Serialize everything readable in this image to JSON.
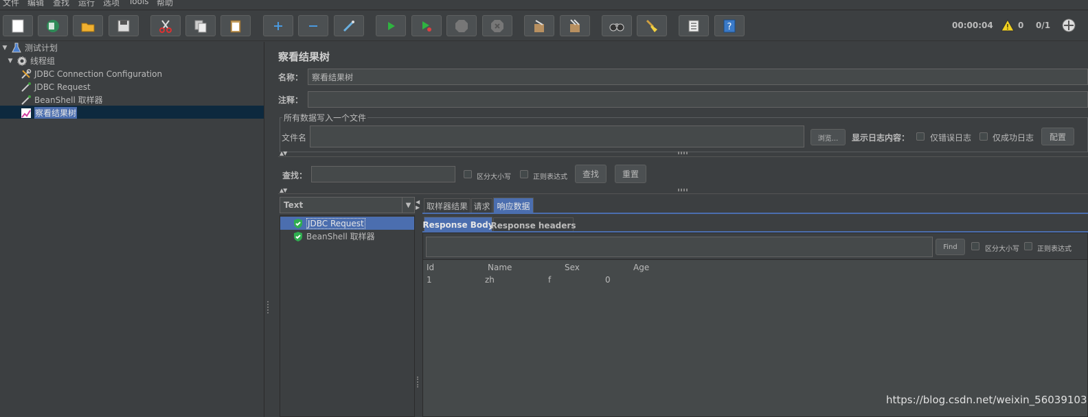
{
  "menubar": {
    "items": [
      "文件",
      "编辑",
      "查找",
      "运行",
      "选项",
      "Tools",
      "帮助"
    ]
  },
  "toolbar": {
    "buttons": [
      "new",
      "templates",
      "open",
      "save",
      "cut",
      "copy",
      "paste",
      "expand",
      "collapse",
      "toggle",
      "start",
      "start-no-pauses",
      "stop",
      "shutdown",
      "clear",
      "clear-all",
      "search",
      "reset-search",
      "function-helper",
      "help"
    ],
    "timer": "00:00:04",
    "warning_count": "0",
    "threads": "0/1"
  },
  "tree": {
    "items": [
      {
        "label": "测试计划",
        "icon": "flask-icon",
        "level": 0
      },
      {
        "label": "线程组",
        "icon": "gear-icon",
        "level": 1
      },
      {
        "label": "JDBC Connection Configuration",
        "icon": "wrench-icon",
        "level": 2
      },
      {
        "label": "JDBC Request",
        "icon": "pipette-icon",
        "level": 2
      },
      {
        "label": "BeanShell 取样器",
        "icon": "pipette-icon",
        "level": 2
      },
      {
        "label": "察看结果树",
        "icon": "chart-icon",
        "level": 2,
        "selected": true
      }
    ]
  },
  "panel": {
    "title": "察看结果树",
    "name_label": "名称：",
    "name_value": "察看结果树",
    "comment_label": "注释：",
    "comment_value": "",
    "file_group_title": "所有数据写入一个文件",
    "filename_label": "文件名",
    "filename_value": "",
    "browse_label": "浏览...",
    "log_content_label": "显示日志内容：",
    "errors_only_label": "仅错误日志",
    "success_only_label": "仅成功日志",
    "configure_label": "配置",
    "search_label": "查找：",
    "search_value": "",
    "case_label": "区分大小写",
    "regex_label": "正则表达式",
    "find_button": "查找",
    "reset_button": "重置"
  },
  "results": {
    "renderer": "Text",
    "items": [
      {
        "label": "JDBC Request",
        "selected": true
      },
      {
        "label": "BeanShell 取样器",
        "selected": false
      }
    ]
  },
  "detail": {
    "tabs": [
      "取样器结果",
      "请求",
      "响应数据"
    ],
    "active_tab": "响应数据",
    "subtabs": [
      "Response Body",
      "Response headers"
    ],
    "active_subtab": "Response Body",
    "find_label": "Find",
    "case_label": "区分大小写",
    "regex_label": "正则表达式",
    "table": {
      "headers": [
        "Id",
        "Name",
        "Sex",
        "Age"
      ],
      "rows": [
        [
          "1",
          "zh",
          "f",
          "0"
        ]
      ]
    }
  },
  "colors": {
    "background": "#3c3f41",
    "selection": "#4b6eaf",
    "tree_selection": "#0d293e"
  },
  "watermark": "https://blog.csdn.net/weixin_56039103"
}
